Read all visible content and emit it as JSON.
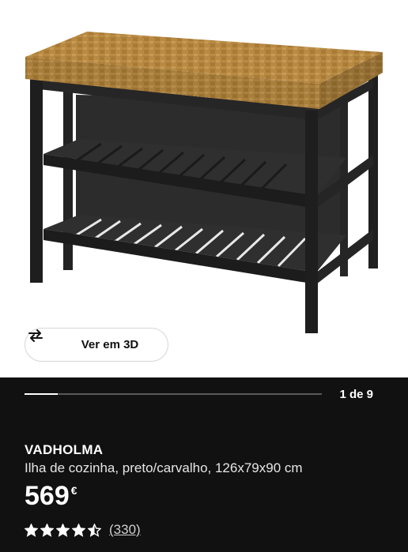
{
  "product_image": {
    "alt": "Ilha de cozinha VADHOLMA"
  },
  "view_3d": {
    "label": "Ver em 3D",
    "icon": "rotate-3d-icon"
  },
  "gallery": {
    "counter": "1 de 9",
    "current": 1,
    "total": 9
  },
  "product": {
    "name": "VADHOLMA",
    "description": "Ilha de cozinha, preto/carvalho, 126x79x90 cm",
    "price": "569",
    "currency": "€"
  },
  "rating": {
    "stars": 4.5,
    "max": 5,
    "reviews": "(330)"
  },
  "colors": {
    "info_background": "#111111",
    "wood": "#b58840",
    "frame": "#2a2a2a"
  }
}
